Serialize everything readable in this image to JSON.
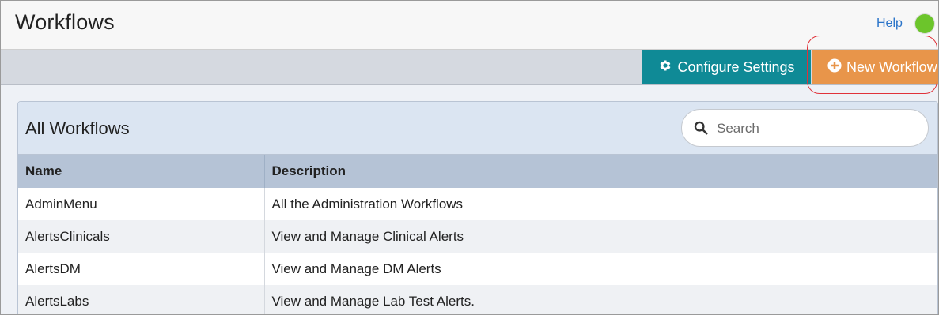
{
  "header": {
    "title": "Workflows",
    "help_label": "Help",
    "status_color": "#6cc52b"
  },
  "toolbar": {
    "configure_label": "Configure Settings",
    "configure_icon": "gear-icon",
    "new_label": "New Workflow",
    "new_icon": "plus-circle-icon"
  },
  "panel": {
    "title": "All Workflows",
    "search": {
      "placeholder": "Search",
      "value": "",
      "icon": "search-icon"
    }
  },
  "table": {
    "columns": [
      "Name",
      "Description"
    ],
    "rows": [
      {
        "name": "AdminMenu",
        "description": "All the Administration Workflows"
      },
      {
        "name": "AlertsClinicals",
        "description": "View and Manage Clinical Alerts"
      },
      {
        "name": "AlertsDM",
        "description": "View and Manage DM Alerts"
      },
      {
        "name": "AlertsLabs",
        "description": "View and Manage Lab Test Alerts."
      }
    ]
  },
  "colors": {
    "configure_button": "#0f8a96",
    "new_button": "#e8954a",
    "highlight_ring": "#e0323a"
  }
}
